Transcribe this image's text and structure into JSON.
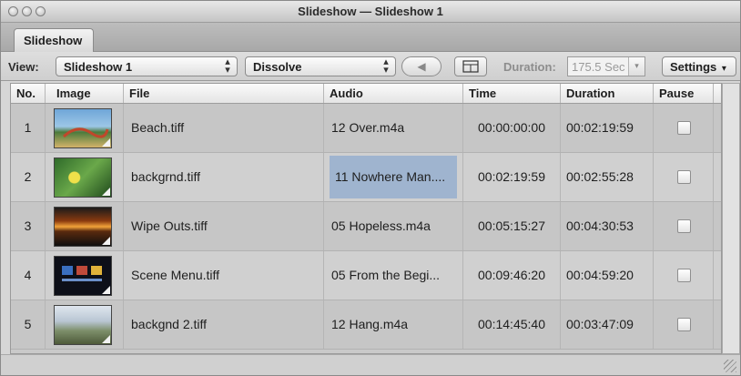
{
  "window": {
    "title": "Slideshow — Slideshow 1"
  },
  "tabs": [
    {
      "label": "Slideshow"
    }
  ],
  "toolbar": {
    "view_label": "View:",
    "view_value": "Slideshow 1",
    "transition_value": "Dissolve",
    "duration_label": "Duration:",
    "duration_value": "175.5 Sec",
    "settings_label": "Settings"
  },
  "table": {
    "columns": [
      "No.",
      "Image",
      "File",
      "Audio",
      "Time",
      "Duration",
      "Pause"
    ],
    "rows": [
      {
        "no": "1",
        "file": "Beach.tiff",
        "audio": "12 Over.m4a",
        "time": "00:00:00:00",
        "duration": "00:02:19:59"
      },
      {
        "no": "2",
        "file": "backgrnd.tiff",
        "audio": "11 Nowhere Man....",
        "time": "00:02:19:59",
        "duration": "00:02:55:28"
      },
      {
        "no": "3",
        "file": "Wipe Outs.tiff",
        "audio": "05 Hopeless.m4a",
        "time": "00:05:15:27",
        "duration": "00:04:30:53"
      },
      {
        "no": "4",
        "file": "Scene Menu.tiff",
        "audio": "05 From the Begi...",
        "time": "00:09:46:20",
        "duration": "00:04:59:20"
      },
      {
        "no": "5",
        "file": "backgnd 2.tiff",
        "audio": "12 Hang.m4a",
        "time": "00:14:45:40",
        "duration": "00:03:47:09"
      }
    ]
  }
}
